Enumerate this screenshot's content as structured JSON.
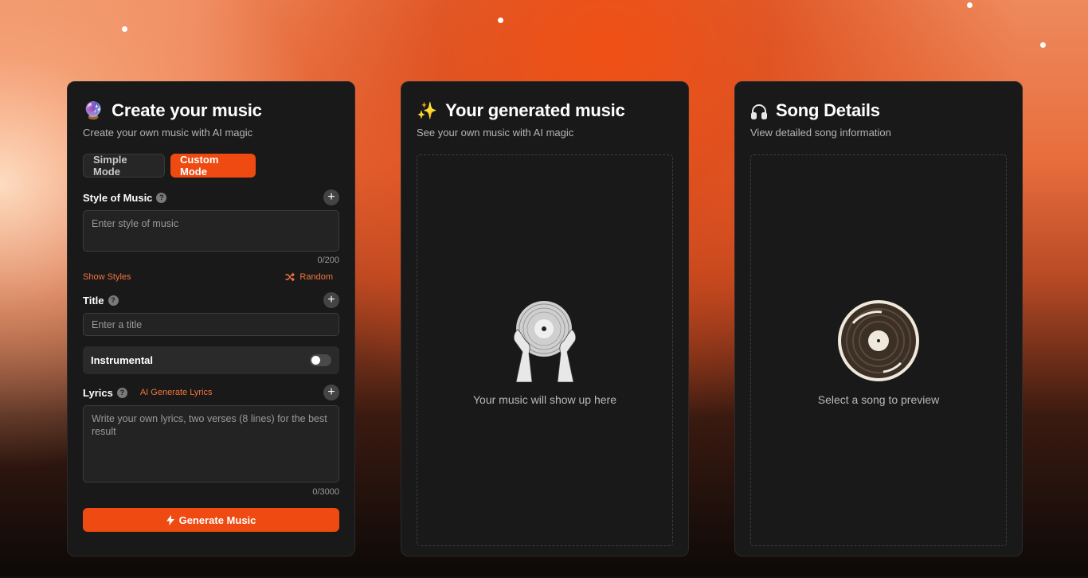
{
  "create_panel": {
    "icon": "crystal-ball-icon",
    "title": "Create your music",
    "subtitle": "Create your own music with AI magic",
    "modes": {
      "simple": "Simple Mode",
      "custom": "Custom Mode",
      "active": "custom"
    },
    "style": {
      "label": "Style of Music",
      "placeholder": "Enter style of music",
      "counter": "0/200",
      "show_styles": "Show Styles",
      "random": "Random"
    },
    "title_field": {
      "label": "Title",
      "placeholder": "Enter a title"
    },
    "instrumental": {
      "label": "Instrumental",
      "on": false
    },
    "lyrics": {
      "label": "Lyrics",
      "ai_generate": "AI Generate Lyrics",
      "placeholder": "Write your own lyrics, two verses (8 lines) for the best result",
      "counter": "0/3000"
    },
    "generate_label": "Generate Music",
    "accent_color": "#ee4a11"
  },
  "generated_panel": {
    "icon": "sparkles-icon",
    "title": "Your generated music",
    "subtitle": "See your own music with AI magic",
    "empty_text": "Your music will show up here"
  },
  "details_panel": {
    "icon": "headphones-icon",
    "title": "Song Details",
    "subtitle": "View detailed song information",
    "empty_text": "Select a song to preview"
  }
}
